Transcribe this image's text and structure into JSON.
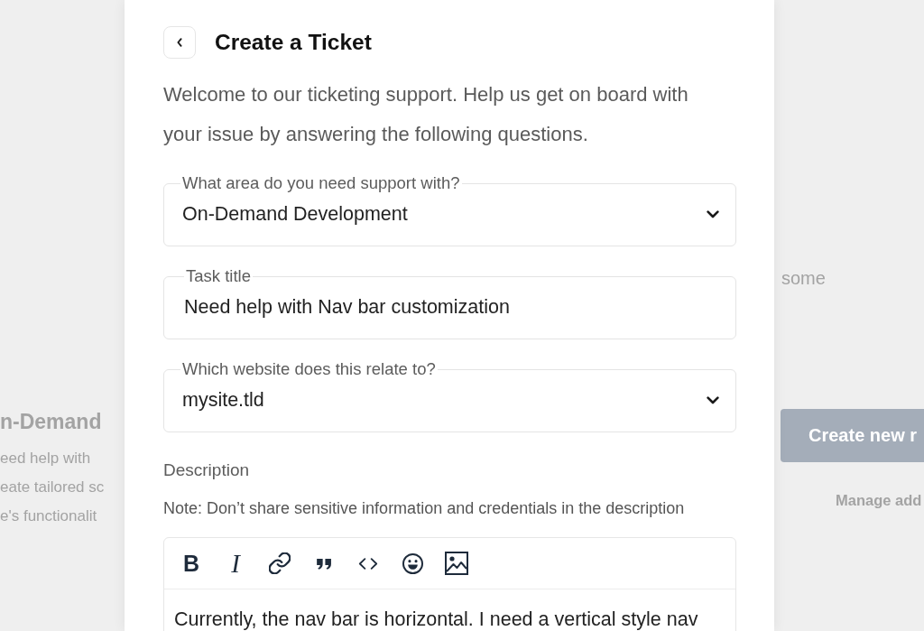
{
  "background": {
    "left_heading": "n-Demand",
    "left_lines": [
      "eed help with",
      "eate tailored sc",
      "e's functionalit"
    ],
    "right_text": "some",
    "right_button": "Create new r",
    "right_link": "Manage add"
  },
  "dialog": {
    "title": "Create a Ticket",
    "intro": "Welcome to our ticketing support. Help us get on board with your issue by answering the following questions.",
    "fields": [
      {
        "kind": "select",
        "label": "What area do you need support with?",
        "value": "On-Demand Development"
      },
      {
        "kind": "text",
        "label": "Task title",
        "value": "Need help with Nav bar customization"
      },
      {
        "kind": "select",
        "label": "Which website does this relate to?",
        "value": "mysite.tld"
      }
    ],
    "description": {
      "label": "Description",
      "note": "Note: Don’t share sensitive information and credentials in the description",
      "toolbar": [
        {
          "kind": "bold",
          "label": "B"
        },
        {
          "kind": "italic",
          "label": "I"
        },
        {
          "kind": "link"
        },
        {
          "kind": "quote"
        },
        {
          "kind": "code"
        },
        {
          "kind": "emoji"
        },
        {
          "kind": "image"
        }
      ],
      "text": "Currently, the nav bar is horizontal. I need a vertical style nav"
    }
  }
}
